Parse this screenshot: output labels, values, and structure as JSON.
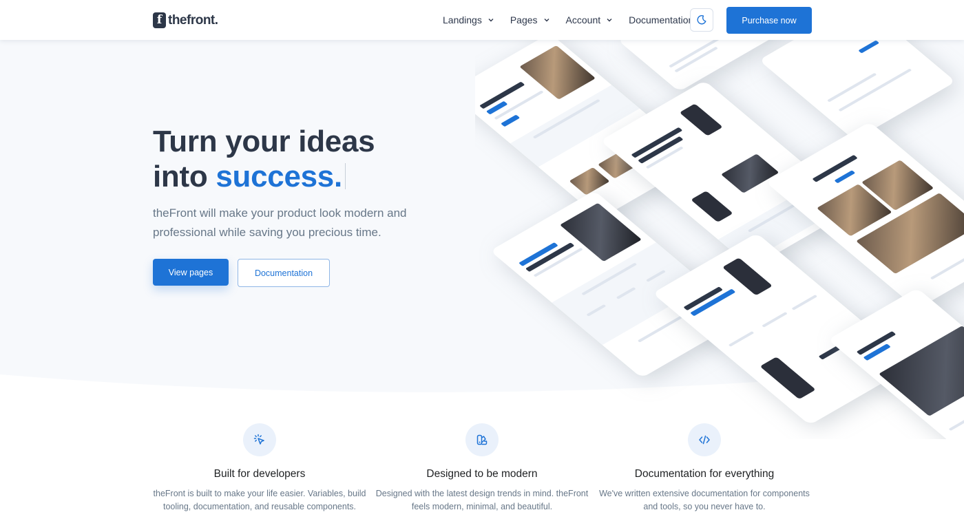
{
  "header": {
    "logo_mark": "f",
    "logo_text": "thefront.",
    "nav": [
      {
        "label": "Landings",
        "icon": "chevron-down-icon"
      },
      {
        "label": "Pages",
        "icon": "chevron-down-icon"
      },
      {
        "label": "Account",
        "icon": "chevron-down-icon"
      },
      {
        "label": "Documentation"
      }
    ],
    "theme_toggle_icon": "moon-icon",
    "purchase_label": "Purchase now"
  },
  "hero": {
    "title_line1": "Turn your ideas",
    "title_line2_prefix": "into ",
    "title_line2_accent": "success.",
    "subtitle": "theFront will make your product look modern and professional while saving you precious time.",
    "primary_button": "View pages",
    "secondary_button": "Documentation"
  },
  "features": [
    {
      "icon": "cursor-click-icon",
      "title": "Built for developers",
      "description": "theFront is built to make your life easier. Variables, build tooling, documentation, and reusable components."
    },
    {
      "icon": "palette-icon",
      "title": "Designed to be modern",
      "description": "Designed with the latest design trends in mind. theFront feels modern, minimal, and beautiful."
    },
    {
      "icon": "code-icon",
      "title": "Documentation for everything",
      "description": "We've written extensive documentation for components and tools, so you never have to."
    }
  ],
  "colors": {
    "primary": "#1e73d6",
    "heading": "#2d3748",
    "body_text": "#677788",
    "hero_background": "#f7f9fc"
  }
}
